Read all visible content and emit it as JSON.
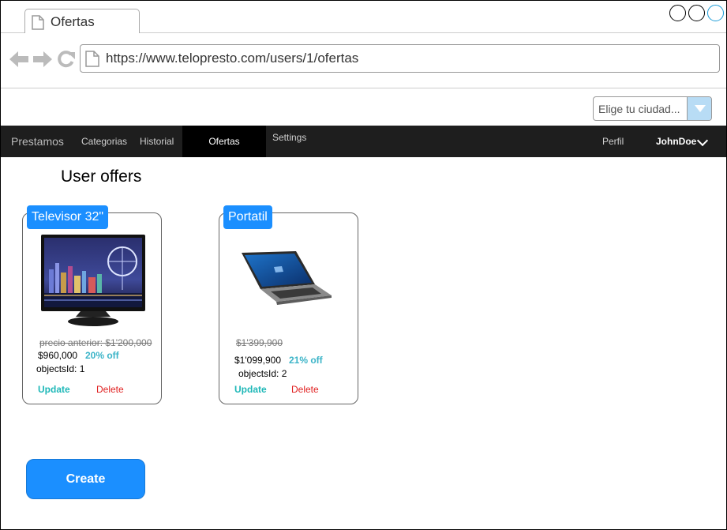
{
  "browser": {
    "tab_title": "Ofertas",
    "url": "https://www.telopresto.com/users/1/ofertas"
  },
  "city_select": {
    "value": "Elige tu ciudad..."
  },
  "navbar": {
    "brand": "Prestamos",
    "items": [
      {
        "label": "Categorias"
      },
      {
        "label": "Historial"
      },
      {
        "label": "Ofertas",
        "active": true
      },
      {
        "label": "Settings"
      }
    ],
    "profile": "Perfil",
    "user": "JohnDoe"
  },
  "page": {
    "title": "User offers"
  },
  "offers": [
    {
      "title": "Televisor 32\"",
      "old_price": "precio anterior: $1'200,000",
      "price": "$960,000",
      "discount": "20% off",
      "objects_id": "objectsId: 1",
      "update": "Update",
      "delete": "Delete"
    },
    {
      "title": "Portatil",
      "old_price": "$1'399,900",
      "price": "$1'099,900",
      "discount": "21% off",
      "objects_id": "objectsId: 2",
      "update": "Update",
      "delete": "Delete"
    }
  ],
  "create_button": "Create",
  "colors": {
    "accent": "#1b8fff",
    "navbar": "#1e1e1e",
    "update": "#1fb8b8",
    "delete": "#e02020",
    "discount": "#3cb4c8"
  }
}
